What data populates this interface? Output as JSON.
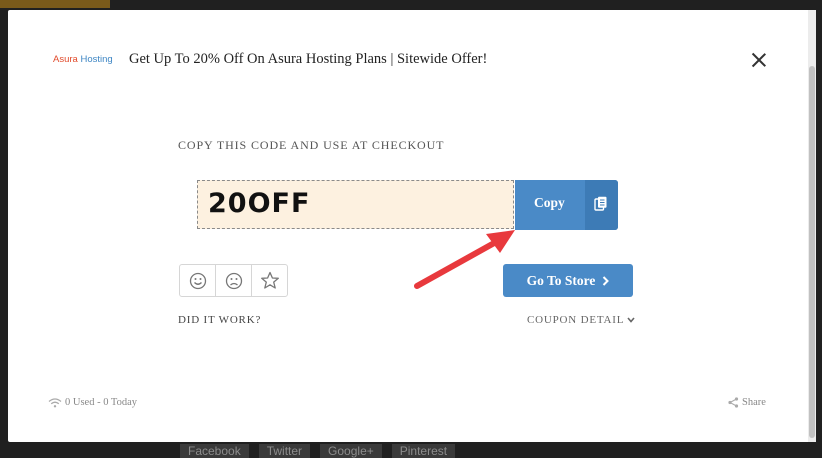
{
  "background": {
    "social_buttons": [
      "Facebook",
      "Twitter",
      "Google+",
      "Pinterest"
    ]
  },
  "modal": {
    "logo": {
      "part1": "Asura",
      "part2": "Hosting"
    },
    "title": "Get Up To 20% Off On Asura Hosting Plans | Sitewide Offer!",
    "instruction": "COPY THIS CODE AND USE AT CHECKOUT",
    "coupon_code": "20OFF",
    "copy_label": "Copy",
    "store_label": "Go To Store",
    "did_it_work": "DID IT WORK?",
    "coupon_detail": "COUPON DETAIL",
    "usage": "0 Used - 0 Today",
    "share_label": "Share"
  },
  "colors": {
    "accent": "#4a8ac7",
    "accent_dark": "#3d7bb6",
    "code_bg": "#fdf1e0",
    "arrow": "#e8393d",
    "overlay": "#202020"
  },
  "icons": [
    "close-icon",
    "copy-icon",
    "happy-face-icon",
    "sad-face-icon",
    "star-icon",
    "chevron-right-icon",
    "chevron-down-icon",
    "wifi-icon",
    "share-icon"
  ]
}
